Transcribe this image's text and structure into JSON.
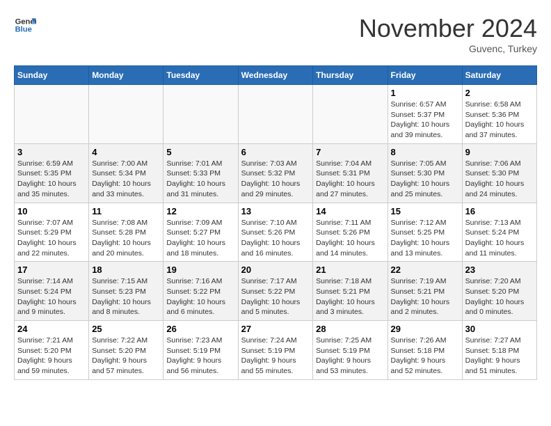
{
  "header": {
    "logo_line1": "General",
    "logo_line2": "Blue",
    "month": "November 2024",
    "location": "Guvenc, Turkey"
  },
  "weekdays": [
    "Sunday",
    "Monday",
    "Tuesday",
    "Wednesday",
    "Thursday",
    "Friday",
    "Saturday"
  ],
  "weeks": [
    {
      "shade": false,
      "days": [
        {
          "num": "",
          "info": ""
        },
        {
          "num": "",
          "info": ""
        },
        {
          "num": "",
          "info": ""
        },
        {
          "num": "",
          "info": ""
        },
        {
          "num": "",
          "info": ""
        },
        {
          "num": "1",
          "info": "Sunrise: 6:57 AM\nSunset: 5:37 PM\nDaylight: 10 hours and 39 minutes."
        },
        {
          "num": "2",
          "info": "Sunrise: 6:58 AM\nSunset: 5:36 PM\nDaylight: 10 hours and 37 minutes."
        }
      ]
    },
    {
      "shade": true,
      "days": [
        {
          "num": "3",
          "info": "Sunrise: 6:59 AM\nSunset: 5:35 PM\nDaylight: 10 hours and 35 minutes."
        },
        {
          "num": "4",
          "info": "Sunrise: 7:00 AM\nSunset: 5:34 PM\nDaylight: 10 hours and 33 minutes."
        },
        {
          "num": "5",
          "info": "Sunrise: 7:01 AM\nSunset: 5:33 PM\nDaylight: 10 hours and 31 minutes."
        },
        {
          "num": "6",
          "info": "Sunrise: 7:03 AM\nSunset: 5:32 PM\nDaylight: 10 hours and 29 minutes."
        },
        {
          "num": "7",
          "info": "Sunrise: 7:04 AM\nSunset: 5:31 PM\nDaylight: 10 hours and 27 minutes."
        },
        {
          "num": "8",
          "info": "Sunrise: 7:05 AM\nSunset: 5:30 PM\nDaylight: 10 hours and 25 minutes."
        },
        {
          "num": "9",
          "info": "Sunrise: 7:06 AM\nSunset: 5:30 PM\nDaylight: 10 hours and 24 minutes."
        }
      ]
    },
    {
      "shade": false,
      "days": [
        {
          "num": "10",
          "info": "Sunrise: 7:07 AM\nSunset: 5:29 PM\nDaylight: 10 hours and 22 minutes."
        },
        {
          "num": "11",
          "info": "Sunrise: 7:08 AM\nSunset: 5:28 PM\nDaylight: 10 hours and 20 minutes."
        },
        {
          "num": "12",
          "info": "Sunrise: 7:09 AM\nSunset: 5:27 PM\nDaylight: 10 hours and 18 minutes."
        },
        {
          "num": "13",
          "info": "Sunrise: 7:10 AM\nSunset: 5:26 PM\nDaylight: 10 hours and 16 minutes."
        },
        {
          "num": "14",
          "info": "Sunrise: 7:11 AM\nSunset: 5:26 PM\nDaylight: 10 hours and 14 minutes."
        },
        {
          "num": "15",
          "info": "Sunrise: 7:12 AM\nSunset: 5:25 PM\nDaylight: 10 hours and 13 minutes."
        },
        {
          "num": "16",
          "info": "Sunrise: 7:13 AM\nSunset: 5:24 PM\nDaylight: 10 hours and 11 minutes."
        }
      ]
    },
    {
      "shade": true,
      "days": [
        {
          "num": "17",
          "info": "Sunrise: 7:14 AM\nSunset: 5:24 PM\nDaylight: 10 hours and 9 minutes."
        },
        {
          "num": "18",
          "info": "Sunrise: 7:15 AM\nSunset: 5:23 PM\nDaylight: 10 hours and 8 minutes."
        },
        {
          "num": "19",
          "info": "Sunrise: 7:16 AM\nSunset: 5:22 PM\nDaylight: 10 hours and 6 minutes."
        },
        {
          "num": "20",
          "info": "Sunrise: 7:17 AM\nSunset: 5:22 PM\nDaylight: 10 hours and 5 minutes."
        },
        {
          "num": "21",
          "info": "Sunrise: 7:18 AM\nSunset: 5:21 PM\nDaylight: 10 hours and 3 minutes."
        },
        {
          "num": "22",
          "info": "Sunrise: 7:19 AM\nSunset: 5:21 PM\nDaylight: 10 hours and 2 minutes."
        },
        {
          "num": "23",
          "info": "Sunrise: 7:20 AM\nSunset: 5:20 PM\nDaylight: 10 hours and 0 minutes."
        }
      ]
    },
    {
      "shade": false,
      "days": [
        {
          "num": "24",
          "info": "Sunrise: 7:21 AM\nSunset: 5:20 PM\nDaylight: 9 hours and 59 minutes."
        },
        {
          "num": "25",
          "info": "Sunrise: 7:22 AM\nSunset: 5:20 PM\nDaylight: 9 hours and 57 minutes."
        },
        {
          "num": "26",
          "info": "Sunrise: 7:23 AM\nSunset: 5:19 PM\nDaylight: 9 hours and 56 minutes."
        },
        {
          "num": "27",
          "info": "Sunrise: 7:24 AM\nSunset: 5:19 PM\nDaylight: 9 hours and 55 minutes."
        },
        {
          "num": "28",
          "info": "Sunrise: 7:25 AM\nSunset: 5:19 PM\nDaylight: 9 hours and 53 minutes."
        },
        {
          "num": "29",
          "info": "Sunrise: 7:26 AM\nSunset: 5:18 PM\nDaylight: 9 hours and 52 minutes."
        },
        {
          "num": "30",
          "info": "Sunrise: 7:27 AM\nSunset: 5:18 PM\nDaylight: 9 hours and 51 minutes."
        }
      ]
    }
  ]
}
